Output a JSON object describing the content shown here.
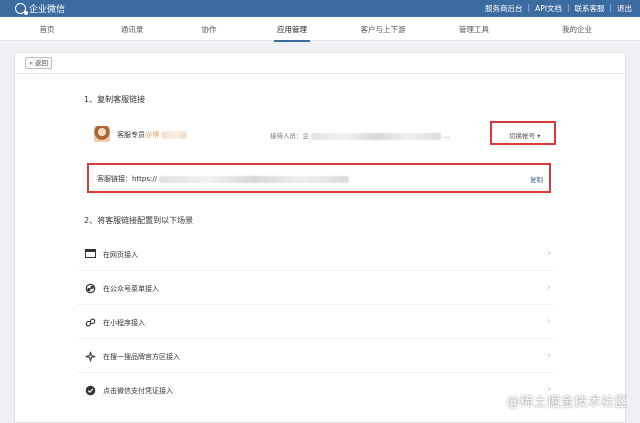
{
  "app": {
    "brand": "企业微信"
  },
  "toplinks": [
    "服务商后台",
    "API文档",
    "联系客服",
    "退出"
  ],
  "nav": {
    "items": [
      {
        "label": "首页",
        "active": false
      },
      {
        "label": "通讯录",
        "active": false
      },
      {
        "label": "协作",
        "active": false
      },
      {
        "label": "应用管理",
        "active": true
      },
      {
        "label": "客户与上下游",
        "active": false
      },
      {
        "label": "管理工具",
        "active": false
      },
      {
        "label": "我的企业",
        "active": false
      }
    ]
  },
  "back_button": "« 返回",
  "section1": {
    "title": "1、复制客服链接",
    "service_name": "客服专员",
    "service_name_suffix": "@博",
    "reception_label": "接待人员：",
    "reception_value": "企",
    "switch_label": "切换帐号 ▾",
    "link_label": "客服链接：",
    "link_value": "https://",
    "copy_label": "复制"
  },
  "section2": {
    "title": "2、将客服链接配置到以下场景",
    "scenes": [
      {
        "label": "在网页接入",
        "icon": "webpage-icon"
      },
      {
        "label": "在公众号菜单接入",
        "icon": "official-account-icon"
      },
      {
        "label": "在小程序接入",
        "icon": "mini-program-icon"
      },
      {
        "label": "在搜一搜品牌官方区接入",
        "icon": "search-brand-icon"
      },
      {
        "label": "点击微信支付凭证接入",
        "icon": "wechat-pay-icon"
      }
    ]
  },
  "colors": {
    "header": "#3c6ba0",
    "highlight": "#d83a3a",
    "link": "#3c6ba0"
  },
  "watermark": "@稀土掘金技术社区"
}
